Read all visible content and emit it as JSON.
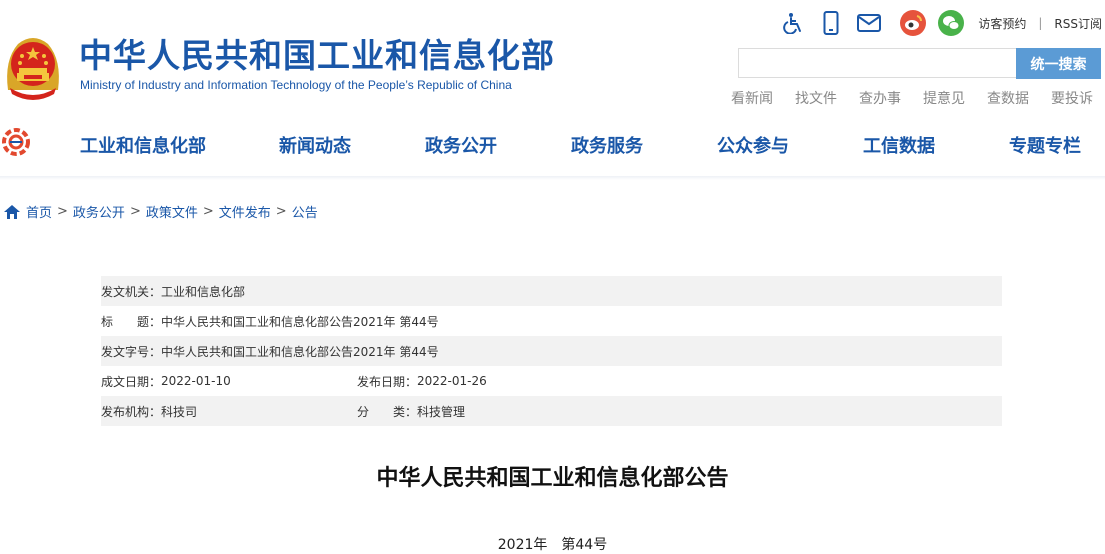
{
  "header": {
    "title": "中华人民共和国工业和信息化部",
    "subtitle": "Ministry of Industry and Information Technology of the People’s Republic of China",
    "tools": {
      "icons": [
        "accessibility-icon",
        "mobile-icon",
        "mail-icon",
        "weibo-icon",
        "wechat-icon"
      ],
      "visitor_booking": "访客预约",
      "separator": "|",
      "rss": "RSS订阅"
    },
    "search": {
      "placeholder": "",
      "button_label": "统一搜索"
    },
    "quick_links": [
      "看新闻",
      "找文件",
      "查办事",
      "提意见",
      "查数据",
      "要投诉"
    ]
  },
  "nav": {
    "items": [
      "工业和信息化部",
      "新闻动态",
      "政务公开",
      "政务服务",
      "公众参与",
      "工信数据",
      "专题专栏"
    ]
  },
  "breadcrumb": {
    "items": [
      "首页",
      "政务公开",
      "政策文件",
      "文件发布",
      "公告"
    ],
    "separator": ">"
  },
  "meta": {
    "issuer_label": "发文机关：",
    "issuer": "工业和信息化部",
    "title_label": "标　　题：",
    "title": "中华人民共和国工业和信息化部公告2021年 第44号",
    "docno_label": "发文字号：",
    "docno": "中华人民共和国工业和信息化部公告2021年 第44号",
    "written_label": "成文日期：",
    "written": "2022-01-10",
    "published_label": "发布日期：",
    "published": "2022-01-26",
    "agency_label": "发布机构：",
    "agency": "科技司",
    "category_label": "分　　类：",
    "category": "科技管理"
  },
  "document": {
    "title": "中华人民共和国工业和信息化部公告",
    "number": "2021年　第44号"
  },
  "colors": {
    "brand_blue": "#1a57a8",
    "search_button": "#5b9bd5",
    "row_shade": "#f2f2f2",
    "weibo_red": "#e6533c",
    "wechat_green": "#49b24a"
  }
}
